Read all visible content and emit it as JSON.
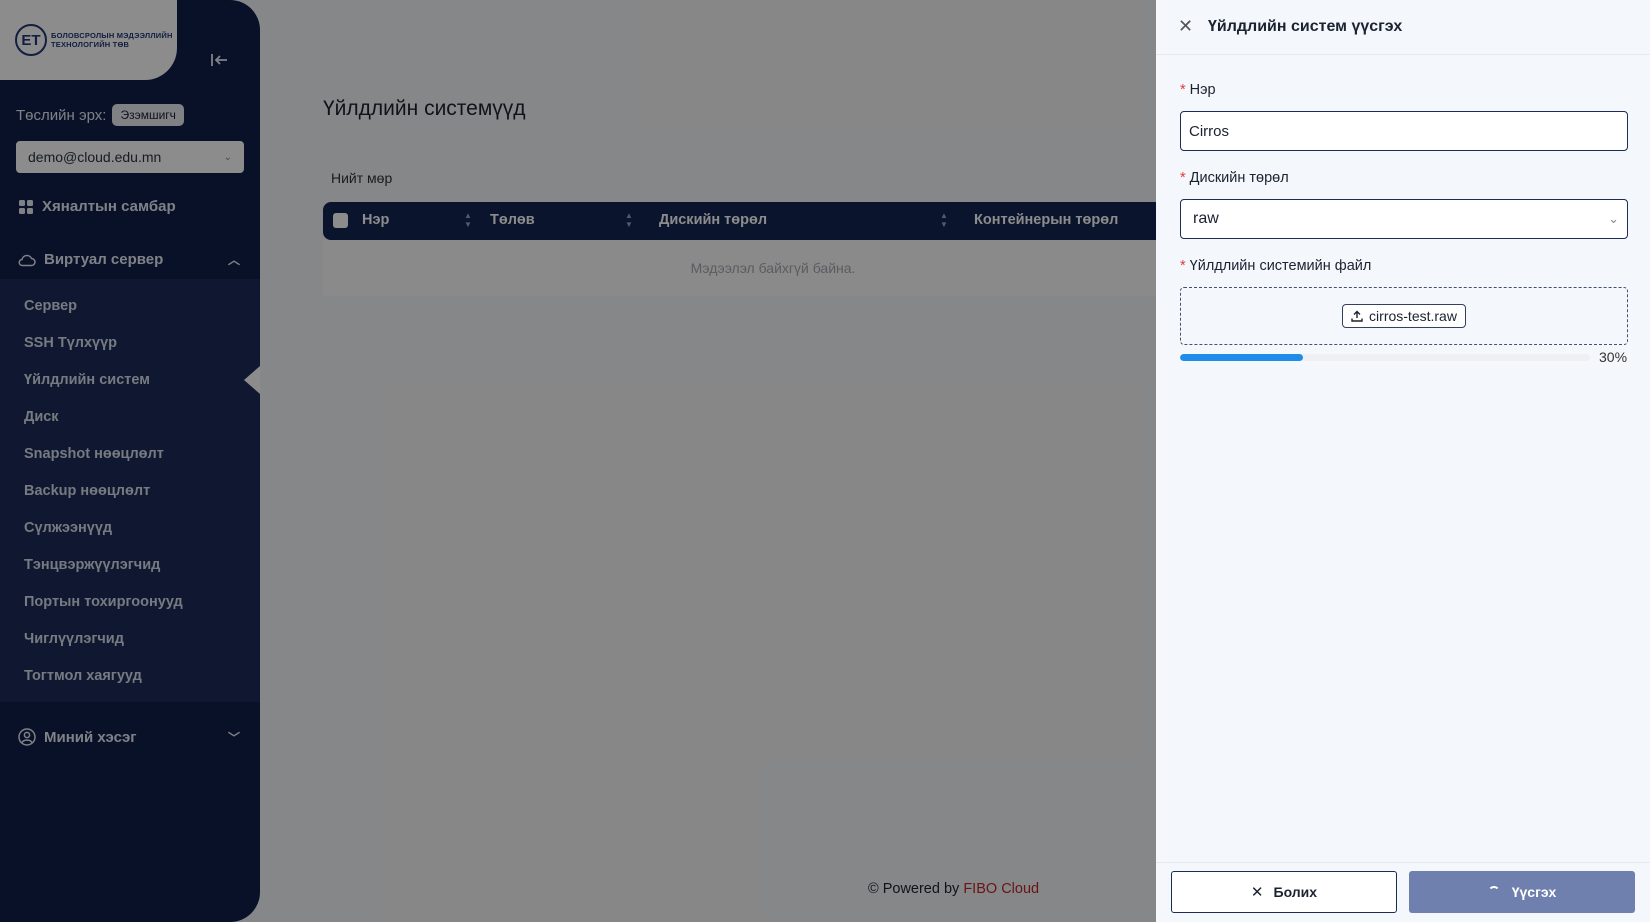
{
  "sidebar": {
    "logo_mark": "ЕТ",
    "logo_line1": "БОЛОВСРОЛЫН МЭДЭЭЛЛИЙН",
    "logo_line2": "ТЕХНОЛОГИЙН ТӨВ",
    "role_label": "Төслийн эрх:",
    "role_badge": "Эзэмшигч",
    "account": "demo@cloud.edu.mn",
    "dashboard": "Хяналтын самбар",
    "virtual_server": "Виртуал сервер",
    "submenu": [
      "Сервер",
      "SSH Түлхүүр",
      "Үйлдлийн систем",
      "Диск",
      "Snapshot нөөцлөлт",
      "Backup нөөцлөлт",
      "Сүлжээнүүд",
      "Тэнцвэржүүлэгчид",
      "Портын тохиргоонууд",
      "Чиглүүлэгчид",
      "Тогтмол хаягууд"
    ],
    "my_section": "Миний хэсэг"
  },
  "main": {
    "title": "Үйлдлийн системүүд",
    "total_rows": "Нийт мөр",
    "columns": [
      "Нэр",
      "Төлөв",
      "Дискийн төрөл",
      "Контейнерын төрөл"
    ],
    "empty": "Мэдээлэл байхгүй байна.",
    "footer_prefix": "© Powered by",
    "footer_brand": "FIBO Cloud"
  },
  "drawer": {
    "title": "Үйлдлийн систем үүсгэх",
    "name_label": "Нэр",
    "name_value": "Cirros",
    "disk_label": "Дискийн төрөл",
    "disk_value": "raw",
    "file_label": "Үйлдлийн системийн файл",
    "file_name": "cirros-test.raw",
    "progress_percent": 30,
    "progress_text": "30%",
    "cancel_label": "Болих",
    "create_label": "Үүсгэх"
  },
  "colors": {
    "sidebar_bg": "#0f1f48",
    "table_header": "#142553",
    "progress": "#1e8de9",
    "brand_red": "#c0272d",
    "create_button": "#7080ae"
  }
}
